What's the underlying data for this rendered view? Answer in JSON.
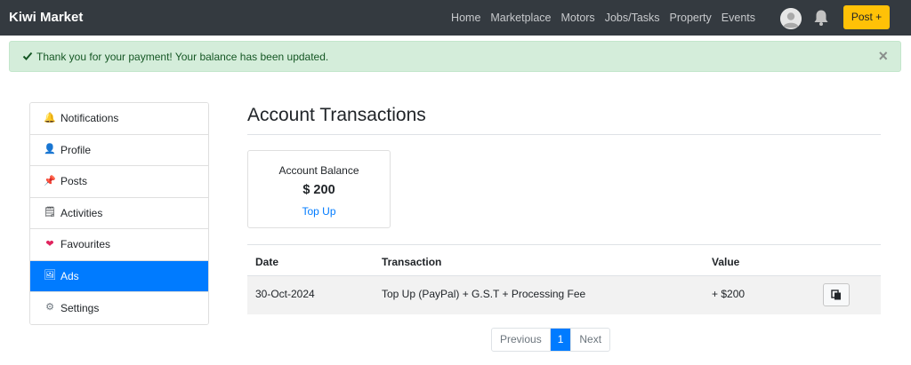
{
  "navbar": {
    "brand": "Kiwi Market",
    "links": [
      "Home",
      "Marketplace",
      "Motors",
      "Jobs/Tasks",
      "Property",
      "Events"
    ],
    "avatar_icon": "user-avatar-icon",
    "bell_icon": "bell-icon",
    "post_label": "Post +",
    "post_color": "#ffc107",
    "background": "#343a40"
  },
  "alert": {
    "icon": "check-icon",
    "message": "Thank you for your payment! Your balance has been updated.",
    "close": "×",
    "background": "#d4edda",
    "text_color": "#155724"
  },
  "sidebar": {
    "items": [
      {
        "label": "Notifications",
        "icon": "bell-icon",
        "glyph": "🔔"
      },
      {
        "label": "Profile",
        "icon": "user-icon",
        "glyph": "👤"
      },
      {
        "label": "Posts",
        "icon": "pin-icon",
        "glyph": "📌"
      },
      {
        "label": "Activities",
        "icon": "notepad-icon",
        "glyph": "🗒"
      },
      {
        "label": "Favourites",
        "icon": "heart-icon",
        "glyph": "❤"
      },
      {
        "label": "Ads",
        "icon": "picture-icon",
        "glyph": "🖼",
        "active": true
      },
      {
        "label": "Settings",
        "icon": "gear-icon",
        "glyph": "⚙"
      }
    ],
    "active_color": "#007bff"
  },
  "main": {
    "title": "Account Transactions",
    "balance": {
      "label": "Account Balance",
      "amount": "$ 200",
      "top_up": "Top Up"
    },
    "table": {
      "headers": [
        "Date",
        "Transaction",
        "Value"
      ],
      "rows": [
        {
          "date": "30-Oct-2024",
          "transaction": "Top Up (PayPal) + G.S.T + Processing Fee",
          "value": "+ $200",
          "action_icon": "copy-icon"
        }
      ]
    },
    "pagination": {
      "previous": "Previous",
      "current": "1",
      "next": "Next"
    }
  }
}
